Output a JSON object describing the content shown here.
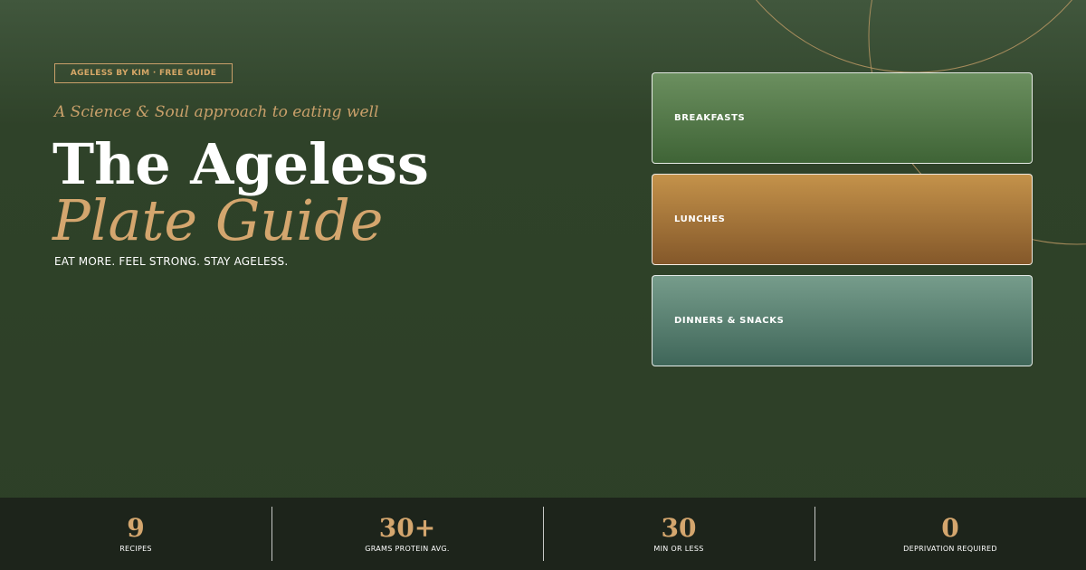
{
  "header": {
    "badge": "AGELESS BY KIM  ·  FREE GUIDE",
    "tagline": "A Science & Soul approach to eating well",
    "title_line1": "The Ageless",
    "title_line2": "Plate Guide",
    "slogan": "EAT MORE. FEEL STRONG. STAY AGELESS."
  },
  "cards": [
    {
      "label": "BREAKFASTS"
    },
    {
      "label": "LUNCHES"
    },
    {
      "label": "DINNERS & SNACKS"
    }
  ],
  "stats": [
    {
      "value": "9",
      "label": "RECIPES"
    },
    {
      "value": "30+",
      "label": "GRAMS PROTEIN AVG."
    },
    {
      "value": "30",
      "label": "MIN OR LESS"
    },
    {
      "value": "0",
      "label": "DEPRIVATION REQUIRED"
    }
  ],
  "colors": {
    "background": "#2d3f27",
    "accent_gold": "#d4a66e",
    "stats_bar": "#1d241b",
    "card_breakfast": "#55794b",
    "card_lunch": "#a5743a",
    "card_dinner": "#5a8272"
  }
}
